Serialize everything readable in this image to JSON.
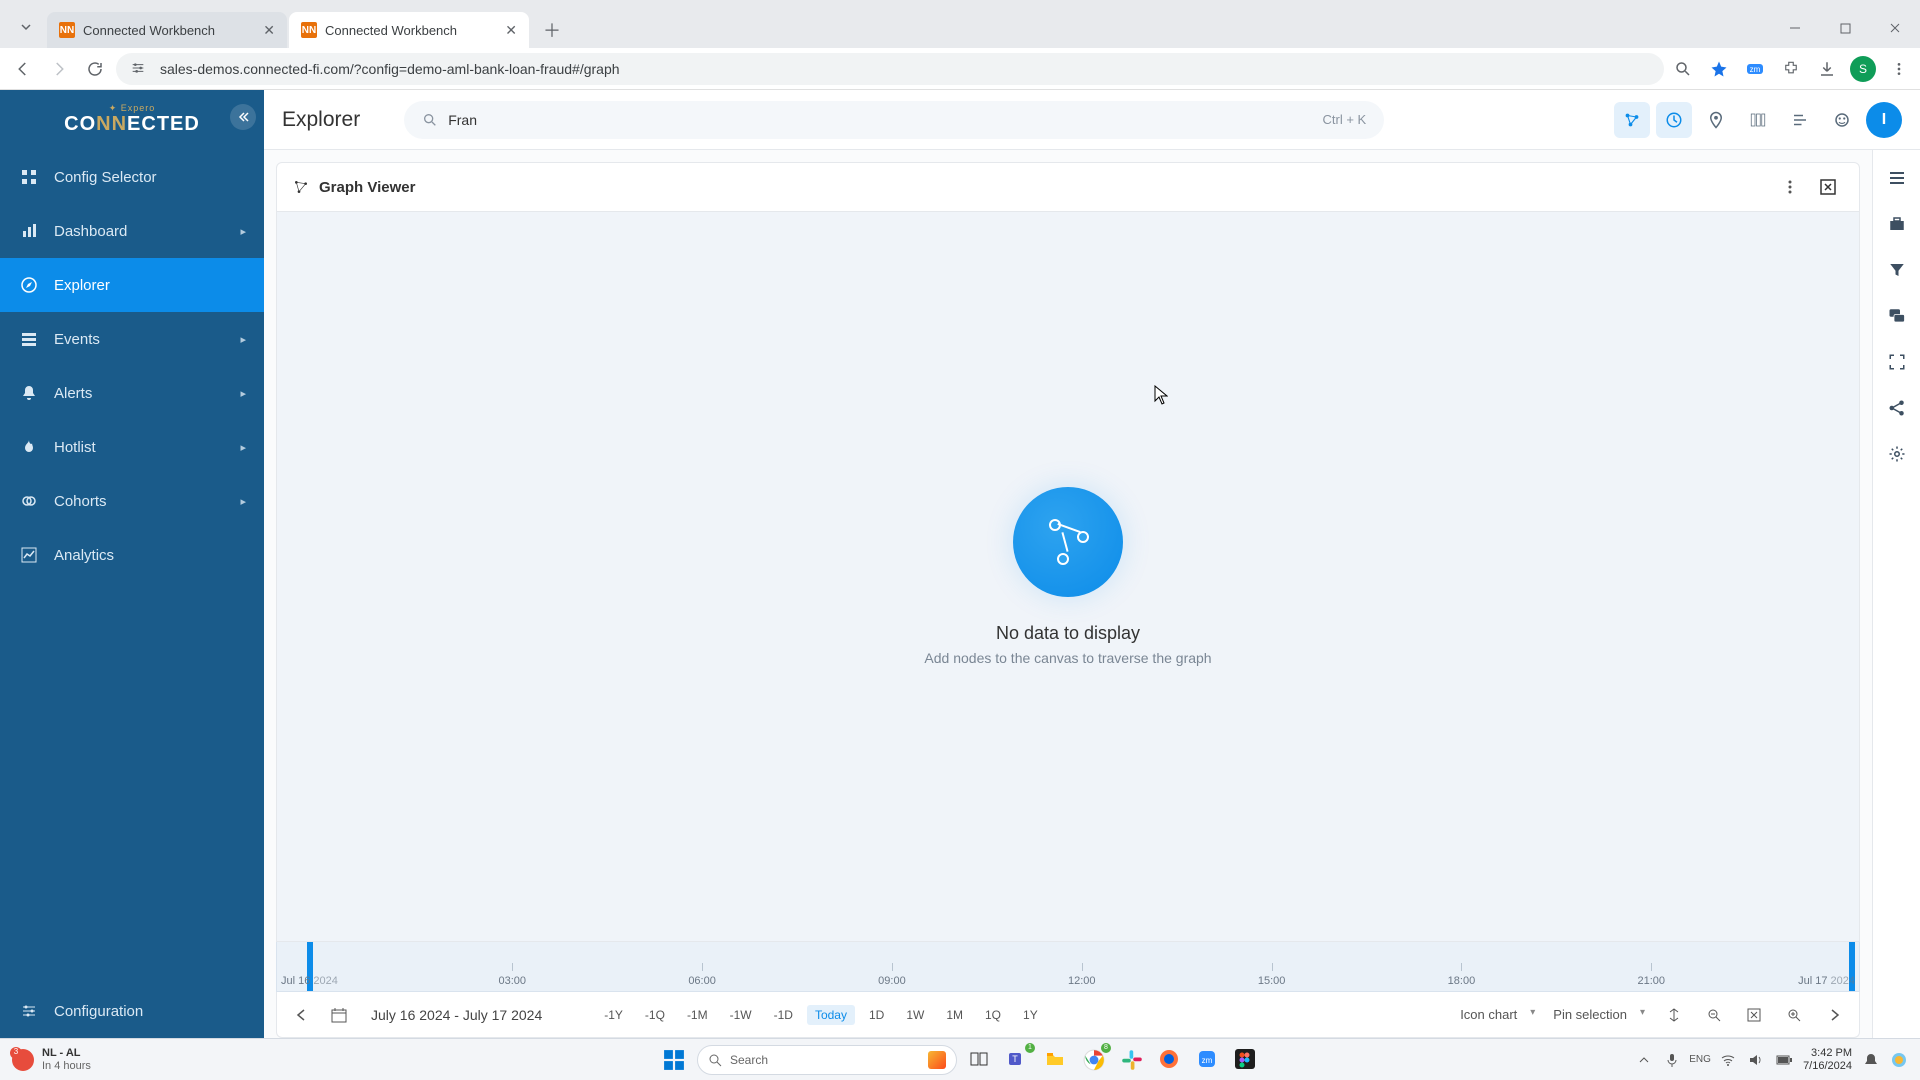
{
  "browser": {
    "tabs": [
      {
        "title": "Connected Workbench",
        "favicon_label": "NN"
      },
      {
        "title": "Connected Workbench",
        "favicon_label": "NN"
      }
    ],
    "url": "sales-demos.connected-fi.com/?config=demo-aml-bank-loan-fraud#/graph",
    "profile_initial": "S"
  },
  "app": {
    "logo_top": "Expero",
    "logo_main_pre": "CO",
    "logo_main_mid": "NN",
    "logo_main_post": "ECTED",
    "sidebar": [
      {
        "label": "Config Selector",
        "icon": "grid",
        "expandable": false
      },
      {
        "label": "Dashboard",
        "icon": "bar",
        "expandable": true
      },
      {
        "label": "Explorer",
        "icon": "compass",
        "expandable": false,
        "active": true
      },
      {
        "label": "Events",
        "icon": "list",
        "expandable": true
      },
      {
        "label": "Alerts",
        "icon": "bell",
        "expandable": true
      },
      {
        "label": "Hotlist",
        "icon": "fire",
        "expandable": true
      },
      {
        "label": "Cohorts",
        "icon": "circles",
        "expandable": true
      },
      {
        "label": "Analytics",
        "icon": "chart",
        "expandable": false
      }
    ],
    "sidebar_footer": {
      "label": "Configuration",
      "icon": "sliders"
    },
    "page_title": "Explorer",
    "search_value": "Fran",
    "search_shortcut": "Ctrl + K",
    "avatar_initial": "I",
    "panel_title": "Graph Viewer",
    "empty_title": "No data to display",
    "empty_subtitle": "Add nodes to the canvas to traverse the graph",
    "timeline": {
      "start_label": "Jul 16",
      "start_year": "2024",
      "end_label": "Jul 17",
      "end_year": "2024",
      "ticks": [
        "03:00",
        "06:00",
        "09:00",
        "12:00",
        "15:00",
        "18:00",
        "21:00"
      ],
      "date_range": "July 16 2024 - July 17 2024",
      "range_buttons": [
        "-1Y",
        "-1Q",
        "-1M",
        "-1W",
        "-1D",
        "Today",
        "1D",
        "1W",
        "1M",
        "1Q",
        "1Y"
      ],
      "range_selected": "Today",
      "chart_type": "Icon chart",
      "pin_label": "Pin selection"
    }
  },
  "taskbar": {
    "weather_line1": "NL - AL",
    "weather_line2": "In 4 hours",
    "weather_badge": "3",
    "search_placeholder": "Search",
    "time": "3:42 PM",
    "date": "7/16/2024"
  }
}
